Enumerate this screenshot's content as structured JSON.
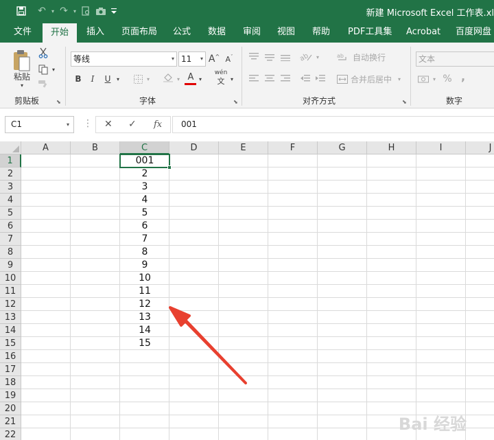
{
  "app": {
    "title": "新建 Microsoft Excel 工作表.xl"
  },
  "tabs": [
    "文件",
    "开始",
    "插入",
    "页面布局",
    "公式",
    "数据",
    "审阅",
    "视图",
    "帮助",
    "PDF工具集",
    "Acrobat",
    "百度网盘"
  ],
  "active_tab": "开始",
  "ribbon": {
    "clipboard": {
      "paste": "粘贴",
      "label": "剪贴板"
    },
    "font": {
      "name": "等线",
      "size": "11",
      "bold": "B",
      "italic": "I",
      "underline": "U",
      "increase": "A",
      "decrease": "A",
      "font_color": "A",
      "wen": "wén",
      "wen2": "文",
      "label": "字体"
    },
    "alignment": {
      "wrap_text": "自动换行",
      "merge_center": "合并后居中",
      "label": "对齐方式"
    },
    "number": {
      "format": "文本",
      "percent": "%",
      "comma": ",",
      "label": "数字"
    }
  },
  "formula_bar": {
    "name_box": "C1",
    "cancel": "✕",
    "enter": "✓",
    "fx": "fx",
    "value": "001"
  },
  "columns": [
    "A",
    "B",
    "C",
    "D",
    "E",
    "F",
    "G",
    "H",
    "I",
    "J"
  ],
  "selected_column": "C",
  "rows": [
    "1",
    "2",
    "3",
    "4",
    "5",
    "6",
    "7",
    "8",
    "9",
    "10",
    "11",
    "12",
    "13",
    "14",
    "15",
    "16",
    "17",
    "18",
    "19",
    "20",
    "21",
    "22"
  ],
  "selected_row": "1",
  "cells_c": [
    "001",
    "2",
    "3",
    "4",
    "5",
    "6",
    "7",
    "8",
    "9",
    "10",
    "11",
    "12",
    "13",
    "14",
    "15"
  ],
  "watermark": "Bai 经验",
  "colors": {
    "excel_green": "#217346",
    "arrow_red": "#e8402f"
  }
}
